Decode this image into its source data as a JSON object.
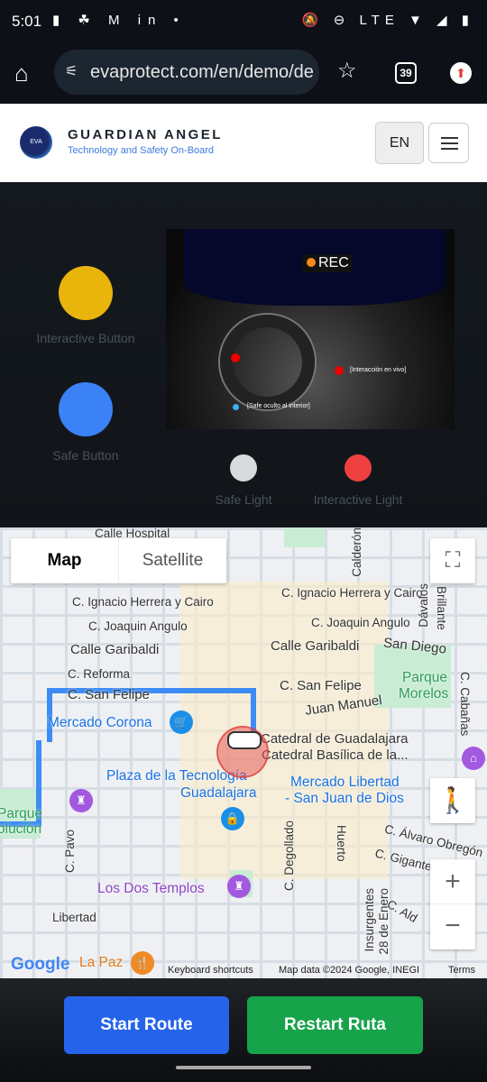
{
  "status_bar": {
    "time": "5:01",
    "left_icons": "▮ ☘ M in •",
    "right_icons": "🔕 ⊖ LTE ▼ ◢ ▮"
  },
  "browser": {
    "url": "evaprotect.com/en/demo/de",
    "tab_count": "39"
  },
  "header": {
    "logo_text": "EVA",
    "brand": "GUARDIAN ANGEL",
    "tagline": "Technology and Safety On-Board",
    "lang": "EN"
  },
  "demo": {
    "interactive_button_label": "Interactive Button",
    "safe_button_label": "Safe Button",
    "safe_light_label": "Safe Light",
    "interactive_light_label": "Interactive Light",
    "rec": "REC",
    "live_label": "[Interacción en vivo]",
    "safe_hidden_label": "[Safe oculto al interior]",
    "colors": {
      "interactive_button": "#e9b40c",
      "safe_button": "#3b82f6",
      "safe_light": "#d8dade",
      "interactive_light": "#ef4040"
    }
  },
  "map": {
    "type_map": "Map",
    "type_satellite": "Satellite",
    "labels": [
      "Calle Hospital",
      "C. Ignacio Herrera y Cairo",
      "C. Joaquin Angulo",
      "Calle Garibaldi",
      "C. Reforma",
      "C. San Felipe",
      "Mercado Corona",
      "Plaza de la Tecnología",
      "Guadalajara",
      "Parque",
      "olución",
      "C. Pavo",
      "Los Dos Templos",
      "Libertad",
      "La Paz",
      "C. Ignacio Herrera y Cairo",
      "C. Joaquin Angulo",
      "Calle Garibaldi",
      "San Diego",
      "C. San Felipe",
      "Juan Manuel",
      "Parque",
      "Morelos",
      "Catedral de Guadalajara",
      "Catedral Basílica de la...",
      "Mercado Libertad",
      "- San Juan de Dios",
      "C. Degollado",
      "Huerto",
      "C. Álvaro Obregón",
      "C. Gigantes",
      "Insurgentes",
      "28 de Enero",
      "C. Ald",
      "Calderón",
      "Dávalos",
      "Brillante",
      "C. Cabañas"
    ],
    "google": "Google",
    "keyboard_shortcuts": "Keyboard shortcuts",
    "map_data": "Map data ©2024 Google, INEGI",
    "terms": "Terms",
    "route_color": "#3d8cf5"
  },
  "actions": {
    "start_route": "Start Route",
    "restart_route": "Restart Ruta",
    "start_color": "#2563eb",
    "restart_color": "#16a34a"
  }
}
